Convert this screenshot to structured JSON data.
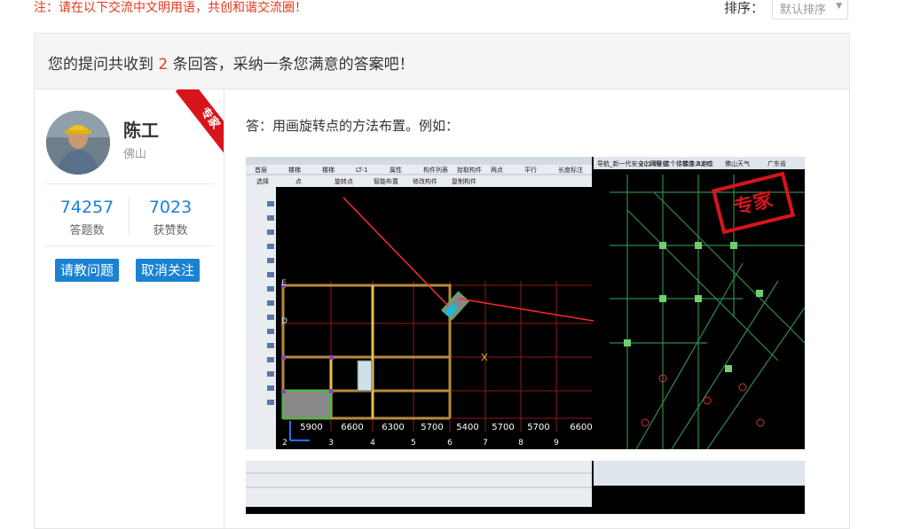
{
  "notice": "注：请在以下交流中文明用语，共创和谐交流圈！",
  "sort": {
    "label": "排序：",
    "selected": "默认排序"
  },
  "panel": {
    "head_pre": "您的提问共收到",
    "count": "2",
    "head_post": "条回答，采纳一条您满意的答案吧！"
  },
  "expert": {
    "name": "陈工",
    "city": "佛山",
    "badge": "专家",
    "answers": {
      "value": "74257",
      "label": "答题数"
    },
    "likes": {
      "value": "7023",
      "label": "获赞数"
    },
    "ask_button": "请教问题",
    "unfollow_button": "取消关注"
  },
  "answer": {
    "text": "答：用画旋转点的方法布置。例如："
  },
  "screenshot": {
    "watermark": "专家",
    "axis_bottom": [
      "5900",
      "6600",
      "6300",
      "5700",
      "5400",
      "5700",
      "5700",
      "6600"
    ],
    "axis_nums": [
      "2",
      "3",
      "4",
      "5",
      "6",
      "7",
      "8",
      "9"
    ],
    "toolbar_items": [
      "首层",
      "楼梯",
      "楼梯",
      "LT-1",
      "属性",
      "构件列表",
      "拾取构件",
      "两点",
      "平行",
      "长度标注"
    ],
    "toolbar2_items": [
      "选择",
      "点",
      "旋转点",
      "智能布置",
      "修改构件",
      "复制构件"
    ],
    "browser_tabs": [
      "导航_新一代安全上网导航",
      "2013版 这个楼梯怎么定位",
      "软件 8345",
      "佛山天气",
      "广东省"
    ],
    "left_labels": [
      "E",
      "D"
    ]
  },
  "colors": {
    "accent_red": "#e8381b",
    "link_blue": "#1a82d2",
    "badge_red": "#d8141c"
  }
}
